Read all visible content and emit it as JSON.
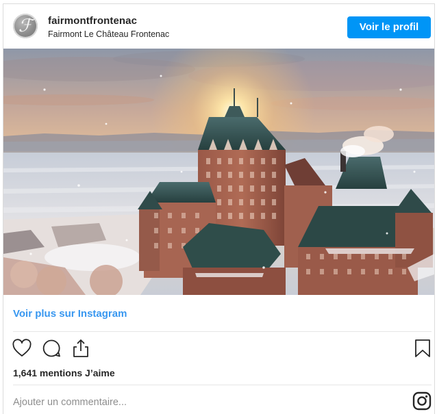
{
  "header": {
    "username": "fairmontfrontenac",
    "subtitle": "Fairmont Le Château Frontenac",
    "profile_button": "Voir le profil"
  },
  "post": {
    "see_more_link": "Voir plus sur Instagram",
    "likes_text": "1,641 mentions J’aime",
    "comment_placeholder": "Ajouter un commentaire..."
  },
  "icons": {
    "like": "heart-icon",
    "comment": "comment-bubble-icon",
    "share": "share-icon",
    "save": "bookmark-icon",
    "brand": "instagram-logo-icon"
  },
  "colors": {
    "accent": "#0095f6",
    "link": "#3897f0",
    "text": "#262626",
    "muted": "#8e8e8e",
    "border": "#dbdbdb"
  }
}
